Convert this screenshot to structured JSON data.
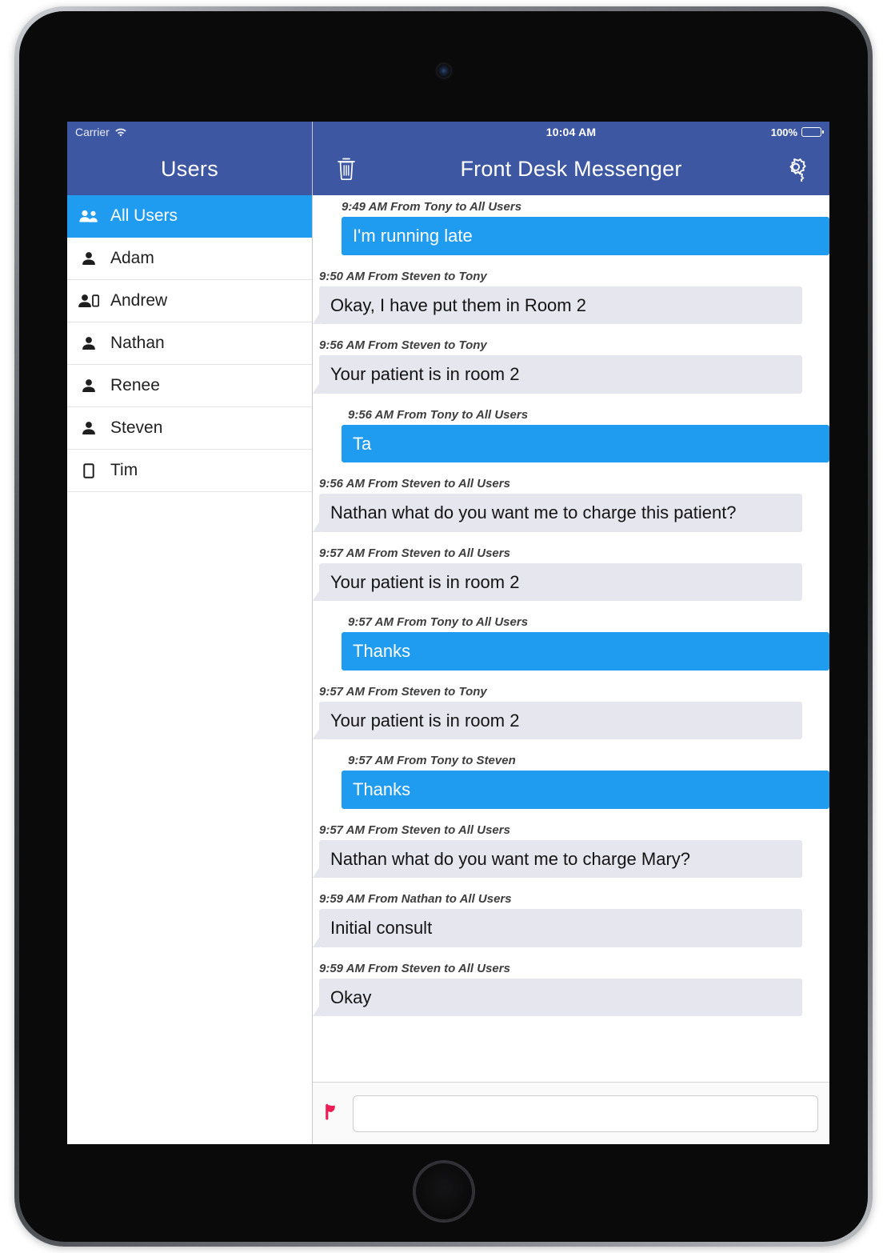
{
  "sidebar": {
    "statusbar": {
      "carrier": "Carrier",
      "wifi_icon": "wifi-icon"
    },
    "title": "Users",
    "items": [
      {
        "label": "All Users",
        "icon": "group-users-icon",
        "selected": true
      },
      {
        "label": "Adam",
        "icon": "person-icon",
        "selected": false
      },
      {
        "label": "Andrew",
        "icon": "person-with-device-icon",
        "selected": false
      },
      {
        "label": "Nathan",
        "icon": "person-icon",
        "selected": false
      },
      {
        "label": "Renee",
        "icon": "person-icon",
        "selected": false
      },
      {
        "label": "Steven",
        "icon": "person-icon",
        "selected": false
      },
      {
        "label": "Tim",
        "icon": "device-icon",
        "selected": false
      }
    ]
  },
  "chat": {
    "statusbar": {
      "clock": "10:04 AM",
      "battery_percent": "100%",
      "battery_icon": "battery-full-icon"
    },
    "title": "Front Desk Messenger",
    "delete_icon": "trash-icon",
    "settings_icon": "gear-icon",
    "messages": [
      {
        "meta": "9:49 AM From Tony to All Users",
        "text": "I'm running late",
        "direction": "outgoing",
        "indented": false
      },
      {
        "meta": "9:50 AM From Steven to Tony",
        "text": "Okay, I have put them in Room 2",
        "direction": "incoming",
        "indented": false
      },
      {
        "meta": "9:56 AM From Steven to Tony",
        "text": "Your patient is in room 2",
        "direction": "incoming",
        "indented": false
      },
      {
        "meta": "9:56 AM From Tony to All Users",
        "text": "Ta",
        "direction": "outgoing",
        "indented": true
      },
      {
        "meta": "9:56 AM From Steven to All Users",
        "text": "Nathan what do you want me to charge this patient?",
        "direction": "incoming",
        "indented": false
      },
      {
        "meta": "9:57 AM From Steven to All Users",
        "text": "Your patient is in room 2",
        "direction": "incoming",
        "indented": false
      },
      {
        "meta": "9:57 AM From Tony to All Users",
        "text": "Thanks",
        "direction": "outgoing",
        "indented": true
      },
      {
        "meta": "9:57 AM From Steven to Tony",
        "text": "Your patient is in room 2",
        "direction": "incoming",
        "indented": false
      },
      {
        "meta": "9:57 AM From Tony to Steven",
        "text": "Thanks",
        "direction": "outgoing",
        "indented": true
      },
      {
        "meta": "9:57 AM From Steven to All Users",
        "text": "Nathan what do you want me to charge Mary?",
        "direction": "incoming",
        "indented": false
      },
      {
        "meta": "9:59 AM From Nathan to All Users",
        "text": "Initial consult",
        "direction": "incoming",
        "indented": false
      },
      {
        "meta": "9:59 AM From Steven to All Users",
        "text": "Okay",
        "direction": "incoming",
        "indented": false
      }
    ],
    "composer": {
      "flag_icon": "flag-icon",
      "input_value": "",
      "input_placeholder": ""
    }
  },
  "colors": {
    "navbar": "#3e57a3",
    "accent_blue": "#1f9bf0",
    "incoming_bubble": "#e6e6ee",
    "flag": "#ec1c54"
  }
}
